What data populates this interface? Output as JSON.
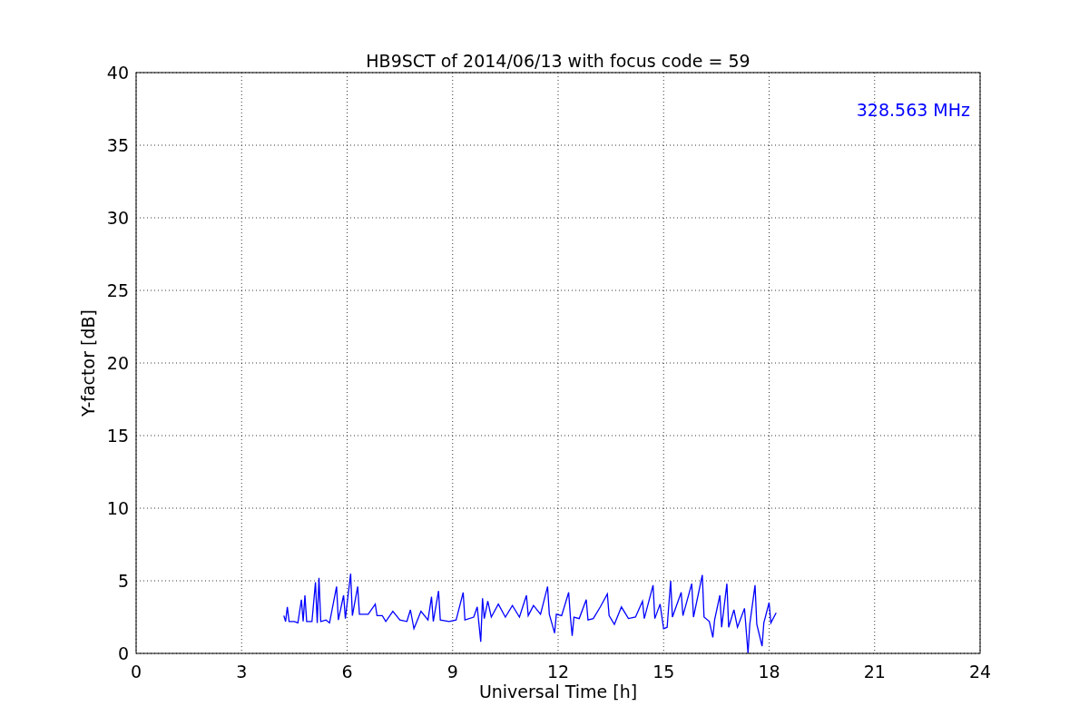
{
  "chart_data": {
    "type": "line",
    "title": "HB9SCT of 2014/06/13 with focus code = 59",
    "xlabel": "Universal Time [h]",
    "ylabel": "Y-factor [dB]",
    "xlim": [
      0,
      24
    ],
    "ylim": [
      0,
      40
    ],
    "xticks": [
      0,
      3,
      6,
      9,
      12,
      15,
      18,
      21,
      24
    ],
    "yticks": [
      0,
      5,
      10,
      15,
      20,
      25,
      30,
      35,
      40
    ],
    "x": [
      4.2,
      4.25,
      4.3,
      4.35,
      4.5,
      4.6,
      4.7,
      4.75,
      4.8,
      4.85,
      5.0,
      5.1,
      5.15,
      5.2,
      5.25,
      5.4,
      5.5,
      5.7,
      5.75,
      5.9,
      5.95,
      6.1,
      6.15,
      6.3,
      6.35,
      6.6,
      6.8,
      6.85,
      7.0,
      7.1,
      7.3,
      7.5,
      7.7,
      7.8,
      7.9,
      8.0,
      8.1,
      8.3,
      8.4,
      8.45,
      8.6,
      8.65,
      8.9,
      9.1,
      9.3,
      9.35,
      9.6,
      9.7,
      9.8,
      9.85,
      9.9,
      10.0,
      10.1,
      10.3,
      10.5,
      10.7,
      10.9,
      11.1,
      11.15,
      11.3,
      11.5,
      11.7,
      11.75,
      11.9,
      11.95,
      12.1,
      12.3,
      12.35,
      12.4,
      12.45,
      12.6,
      12.8,
      12.85,
      13.0,
      13.2,
      13.4,
      13.45,
      13.6,
      13.8,
      14.0,
      14.2,
      14.4,
      14.45,
      14.7,
      14.75,
      14.9,
      15.0,
      15.1,
      15.2,
      15.25,
      15.5,
      15.55,
      15.8,
      15.85,
      16.1,
      16.15,
      16.3,
      16.4,
      16.45,
      16.6,
      16.65,
      16.8,
      16.85,
      17.0,
      17.1,
      17.3,
      17.4,
      17.45,
      17.6,
      17.65,
      17.8,
      17.85,
      18.0,
      18.05,
      18.2
    ],
    "grid": true,
    "series": [
      {
        "color": "#0000ff",
        "values": [
          2.6,
          2.2,
          3.2,
          2.2,
          2.2,
          2.1,
          3.7,
          2.2,
          4.0,
          2.2,
          2.2,
          4.9,
          2.1,
          5.2,
          2.2,
          2.3,
          2.1,
          4.6,
          2.3,
          4.0,
          2.4,
          5.5,
          2.6,
          4.6,
          2.7,
          2.7,
          3.4,
          2.6,
          2.6,
          2.2,
          2.9,
          2.3,
          2.2,
          3.0,
          1.7,
          2.3,
          2.9,
          2.3,
          3.9,
          2.2,
          4.3,
          2.3,
          2.2,
          2.3,
          4.2,
          2.3,
          2.5,
          3.2,
          0.8,
          3.8,
          2.4,
          3.6,
          2.5,
          3.4,
          2.5,
          3.3,
          2.5,
          4.0,
          2.6,
          3.3,
          2.7,
          4.6,
          2.7,
          1.4,
          2.7,
          2.6,
          4.2,
          2.5,
          1.2,
          2.5,
          2.4,
          3.7,
          2.3,
          2.4,
          3.2,
          4.1,
          2.6,
          2.0,
          3.2,
          2.4,
          2.5,
          3.6,
          2.4,
          4.7,
          2.4,
          3.4,
          1.7,
          1.8,
          5.0,
          2.5,
          4.2,
          2.6,
          4.8,
          2.5,
          5.4,
          2.5,
          2.2,
          1.1,
          2.3,
          4.0,
          1.8,
          4.8,
          1.8,
          3.0,
          1.8,
          3.1,
          0.0,
          2.0,
          4.7,
          2.0,
          0.5,
          2.1,
          3.5,
          2.1,
          2.8
        ]
      }
    ],
    "annotations": [
      {
        "text": "328.563 MHz"
      }
    ]
  }
}
